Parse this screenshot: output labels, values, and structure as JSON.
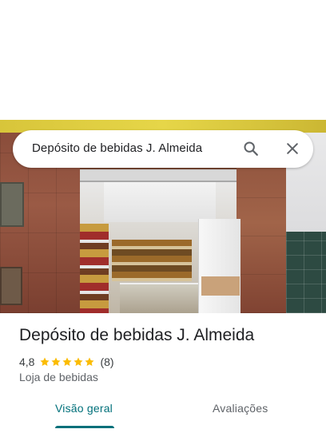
{
  "search": {
    "query": "Depósito de bebidas J. Almeida"
  },
  "place": {
    "name": "Depósito de bebidas J. Almeida",
    "rating": "4,8",
    "rating_stars": 4.8,
    "review_count": "(8)",
    "category": "Loja de bebidas"
  },
  "tabs": [
    {
      "label": "Visão geral",
      "active": true
    },
    {
      "label": "Avaliações",
      "active": false
    }
  ],
  "colors": {
    "accent": "#00707a",
    "star": "#fbbc04"
  },
  "icons": {
    "search": "search-icon",
    "close": "close-icon"
  }
}
